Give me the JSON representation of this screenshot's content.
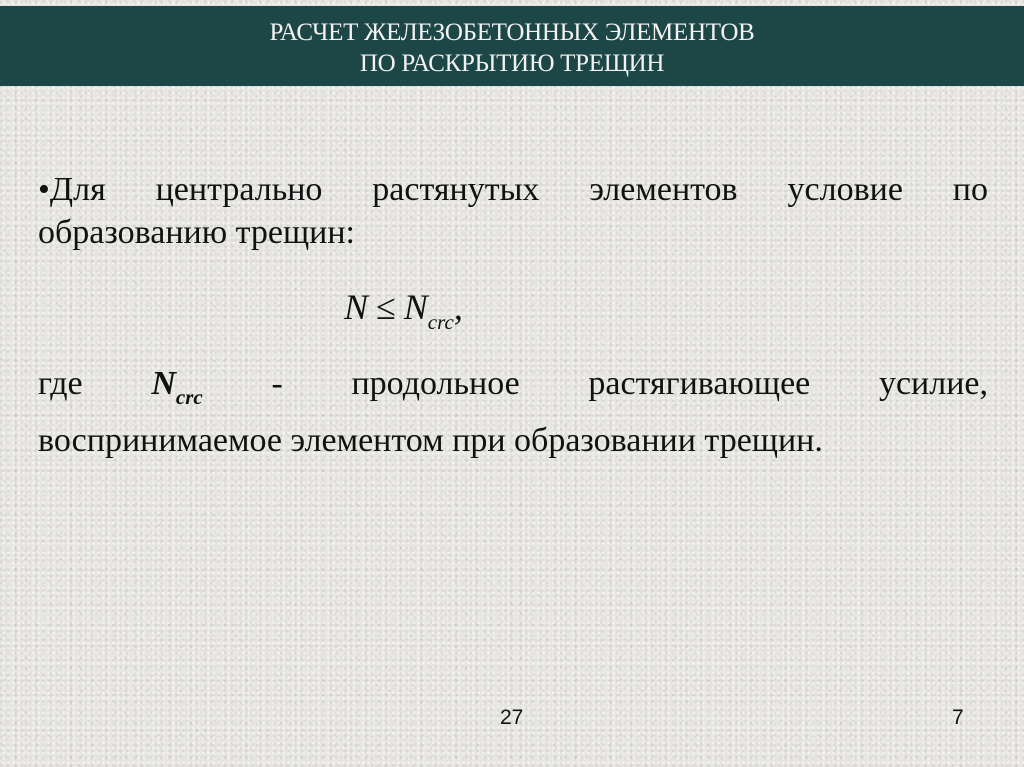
{
  "header": {
    "title_line1": "РАСЧЕТ ЖЕЛЕЗОБЕТОННЫХ ЭЛЕМЕНТОВ",
    "title_line2": "ПО РАСКРЫТИЮ ТРЕЩИН",
    "background_color": "#1c4746"
  },
  "body": {
    "bullet_line1": "•Для центрально растянутых элементов условие по",
    "bullet_line2": "образованию трещин:",
    "formula": {
      "lhs": "N",
      "operator": "≤",
      "rhs": "N",
      "rhs_subscript": "crc",
      "trailing": ","
    },
    "definition_prefix": "где",
    "definition_symbol": "N",
    "definition_subscript": "crc",
    "definition_line1_rest": "- продольное растягивающее усилие,",
    "definition_line2": "воспринимаемое элементом при образовании трещин."
  },
  "footer": {
    "page_left": "27",
    "page_right": "7"
  }
}
